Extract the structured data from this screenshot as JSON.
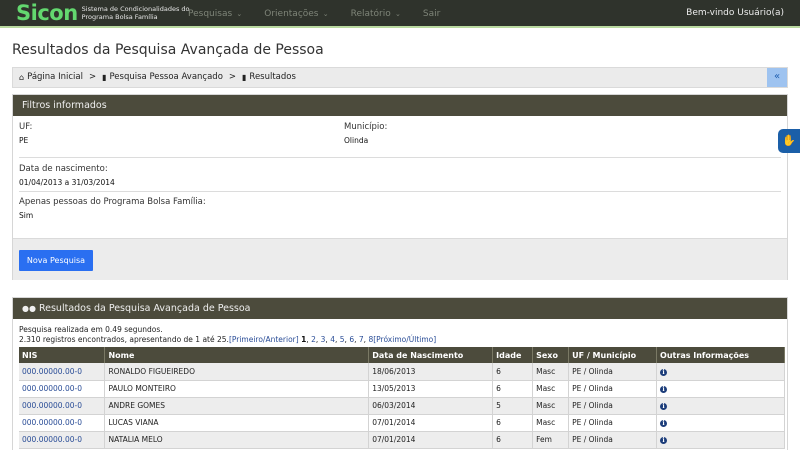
{
  "navbar": {
    "brand_logo": "Sicon",
    "brand_subtitle": "Sistema de Condicionalidades do Programa Bolsa Família",
    "menu": [
      {
        "label": "Pesquisas"
      },
      {
        "label": "Orientações"
      },
      {
        "label": "Relatório"
      },
      {
        "label": "Sair"
      }
    ],
    "welcome": "Bem-vindo Usuário(a)"
  },
  "page": {
    "title": "Resultados da Pesquisa Avançada de Pessoa"
  },
  "breadcrumb": {
    "items": [
      "Página Inicial",
      "Pesquisa Pessoa Avançado",
      "Resultados"
    ],
    "collapse_label": "«"
  },
  "filters": {
    "heading": "Filtros informados",
    "uf_label": "UF:",
    "uf_value": "PE",
    "municipio_label": "Município:",
    "municipio_value": "Olinda",
    "nascimento_label": "Data de nascimento:",
    "nascimento_value": "01/04/2013 a 31/03/2014",
    "bolsa_label": "Apenas pessoas do Programa Bolsa Família:",
    "bolsa_value": "Sim",
    "new_search_button": "Nova Pesquisa"
  },
  "results": {
    "heading": "Resultados da Pesquisa Avançada de Pessoa",
    "timing": "Pesquisa realizada em 0.49 segundos.",
    "count_text": "2.310 registros encontrados, apresentando de 1 até 25.",
    "first_prev": "[Primeiro/Anterior]",
    "current_page": "1",
    "pages": [
      "2",
      "3",
      "4",
      "5",
      "6",
      "7",
      "8"
    ],
    "next_last": "[Próximo/Último]",
    "columns": [
      "NIS",
      "Nome",
      "Data de Nascimento",
      "Idade",
      "Sexo",
      "UF / Município",
      "Outras Informações"
    ],
    "rows": [
      {
        "nis": "000.00000.00-0",
        "nome": "RONALDO FIGUEIREDO",
        "nascimento": "18/06/2013",
        "idade": "6",
        "sexo": "Masc",
        "uf_municipio": "PE / Olinda"
      },
      {
        "nis": "000.00000.00-0",
        "nome": "PAULO MONTEIRO",
        "nascimento": "13/05/2013",
        "idade": "6",
        "sexo": "Masc",
        "uf_municipio": "PE / Olinda"
      },
      {
        "nis": "000.00000.00-0",
        "nome": "ANDRE GOMES",
        "nascimento": "06/03/2014",
        "idade": "5",
        "sexo": "Masc",
        "uf_municipio": "PE / Olinda"
      },
      {
        "nis": "000.00000.00-0",
        "nome": "LUCAS VIANA",
        "nascimento": "07/01/2014",
        "idade": "6",
        "sexo": "Masc",
        "uf_municipio": "PE / Olinda"
      },
      {
        "nis": "000.00000.00-0",
        "nome": "NATALIA MELO",
        "nascimento": "07/01/2014",
        "idade": "6",
        "sexo": "Fem",
        "uf_municipio": "PE / Olinda"
      }
    ]
  },
  "icons": {
    "home": "home-icon",
    "file": "file-icon",
    "users": "users-icon",
    "info": "info-icon",
    "accessibility": "sign-language-icon"
  },
  "colors": {
    "navbar": "#2f332c",
    "brand": "#63d86f",
    "panel_heading": "#4c4b3c",
    "primary_button": "#2a6ff1",
    "link": "#2a4d97"
  }
}
